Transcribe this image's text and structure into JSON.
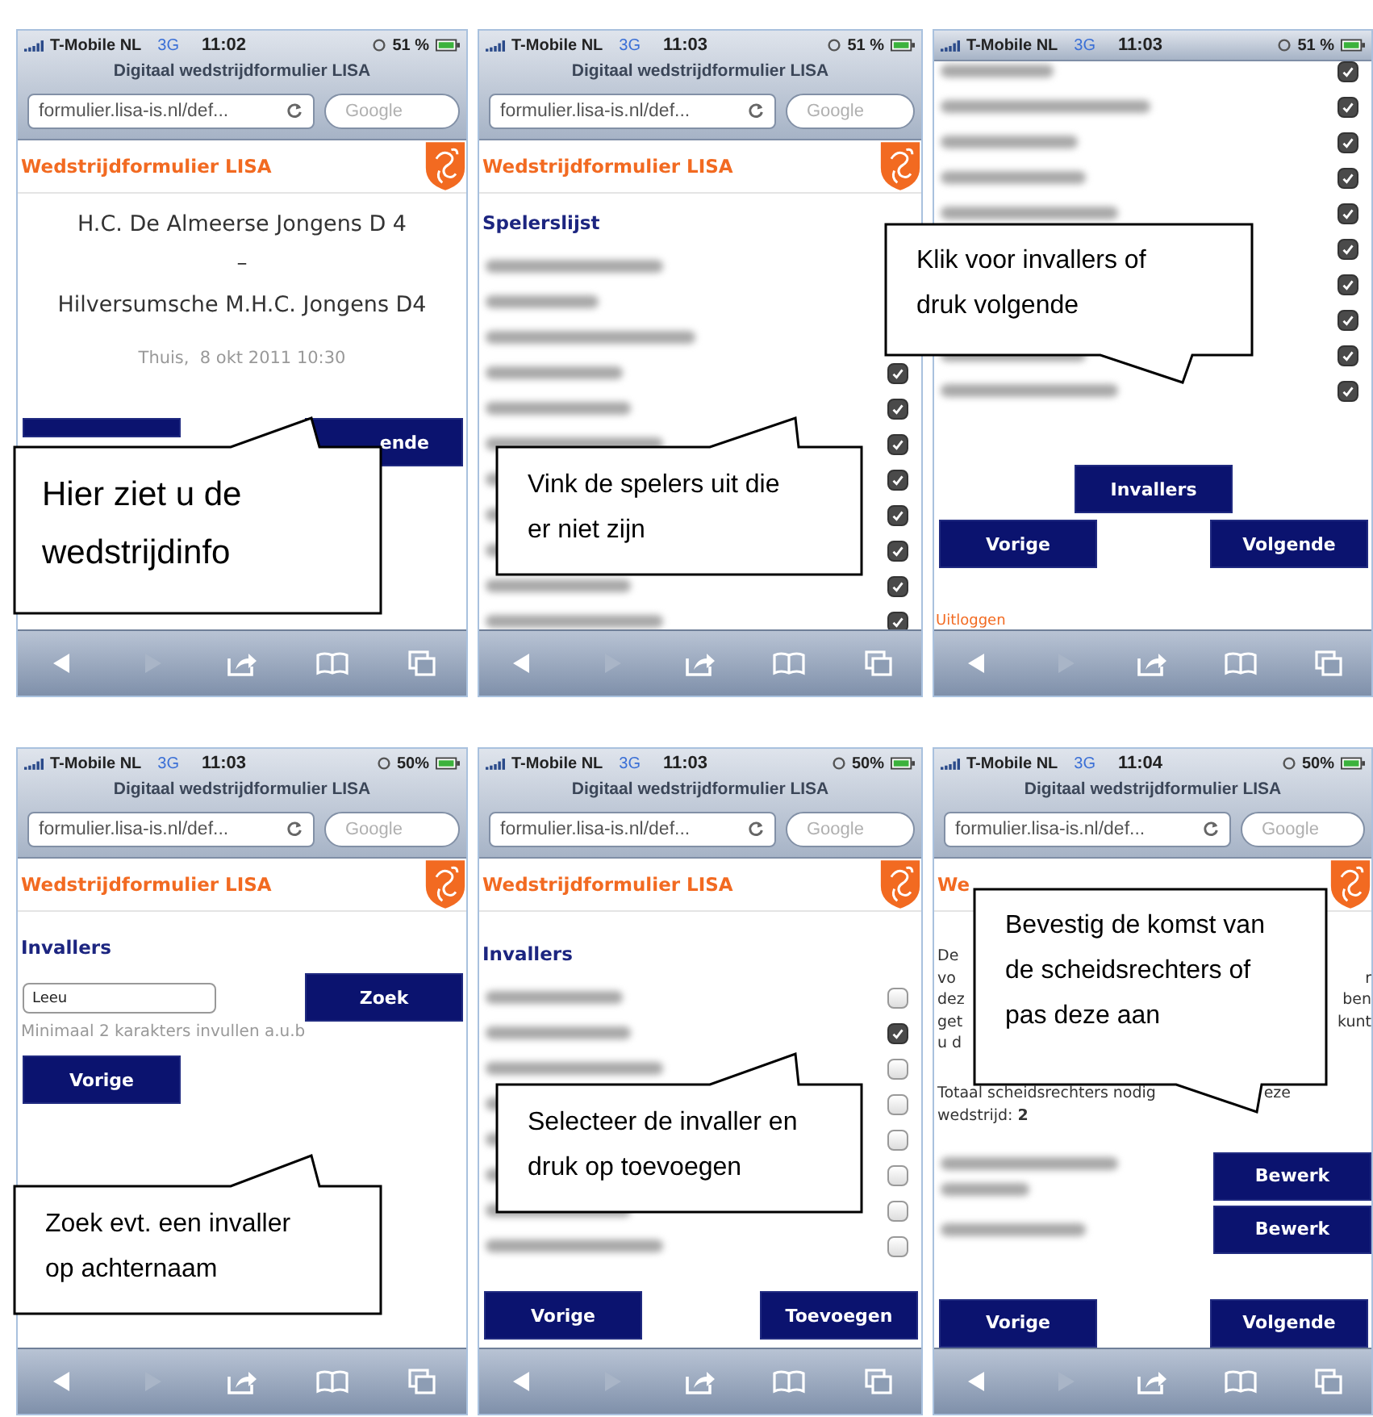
{
  "phones": [
    {
      "status": {
        "carrier": "T-Mobile NL",
        "network": "3G",
        "time": "11:02",
        "battery": "51 %"
      },
      "title": "Digitaal wedstrijdformulier LISA",
      "url": "formulier.lisa-is.nl/def...",
      "search_placeholder": "Google",
      "header": "Wedstrijdformulier LISA",
      "content": [
        {
          "kind": "match",
          "home": "H.C. De Almeerse Jongens D 4",
          "separator": "–",
          "away": "Hilversumsche M.H.C. Jongens D4",
          "info": "Thuis,  8 okt 2011 10:30"
        },
        {
          "kind": "buttons",
          "buttons": [
            {
              "kind": "covered"
            },
            {
              "kind": "tail",
              "label": "ende"
            }
          ]
        }
      ],
      "callout": "Hier ziet u de wedstrijdinfo"
    },
    {
      "status": {
        "carrier": "T-Mobile NL",
        "network": "3G",
        "time": "11:03",
        "battery": "51 %"
      },
      "title": "Digitaal wedstrijdformulier LISA",
      "url": "formulier.lisa-is.nl/def...",
      "search_placeholder": "Google",
      "header": "Wedstrijdformulier LISA",
      "content": [
        {
          "kind": "heading",
          "text": "Spelerslijst"
        },
        {
          "kind": "list",
          "rows": [
            {
              "kind": "name"
            },
            {
              "kind": "name"
            },
            {
              "kind": "name"
            },
            {
              "kind": "check",
              "checked": true
            },
            {
              "kind": "check",
              "checked": true
            },
            {
              "kind": "check",
              "checked": true
            },
            {
              "kind": "check",
              "checked": true
            },
            {
              "kind": "check",
              "checked": true
            },
            {
              "kind": "check",
              "checked": true
            },
            {
              "kind": "check",
              "checked": true
            },
            {
              "kind": "check",
              "checked": true
            }
          ]
        }
      ],
      "callout": "Vink de spelers uit die er niet zijn"
    },
    {
      "status": {
        "carrier": "T-Mobile NL",
        "network": "3G",
        "time": "11:03",
        "battery": "51 %"
      },
      "content": [
        {
          "kind": "list",
          "rows": [
            {
              "kind": "check",
              "checked": true
            },
            {
              "kind": "check",
              "checked": true
            },
            {
              "kind": "check",
              "checked": true
            },
            {
              "kind": "check",
              "checked": true
            },
            {
              "kind": "check",
              "checked": true
            },
            {
              "kind": "check",
              "checked": true
            },
            {
              "kind": "check",
              "checked": true
            },
            {
              "kind": "check",
              "checked": true
            },
            {
              "kind": "check",
              "checked": true
            },
            {
              "kind": "check",
              "checked": true
            }
          ]
        },
        {
          "kind": "buttons",
          "buttons": [
            {
              "kind": "centered",
              "label": "Invallers"
            }
          ]
        },
        {
          "kind": "buttons",
          "buttons": [
            {
              "kind": "full",
              "label": "Vorige"
            },
            {
              "kind": "full",
              "label": "Volgende"
            }
          ]
        },
        {
          "kind": "logout",
          "text": "Uitloggen"
        }
      ],
      "callout": "Klik voor invallers of druk volgende"
    },
    {
      "status": {
        "carrier": "T-Mobile NL",
        "network": "3G",
        "time": "11:03",
        "battery": "50%"
      },
      "title": "Digitaal wedstrijdformulier LISA",
      "url": "formulier.lisa-is.nl/def...",
      "search_placeholder": "Google",
      "header": "Wedstrijdformulier LISA",
      "content": [
        {
          "kind": "heading",
          "text": "Invallers"
        },
        {
          "kind": "search",
          "value": "Leeu",
          "button": "Zoek",
          "hint": "Minimaal 2 karakters invullen a.u.b"
        },
        {
          "kind": "buttons",
          "buttons": [
            {
              "kind": "full",
              "label": "Vorige"
            }
          ]
        }
      ],
      "callout": "Zoek evt. een invaller op achternaam"
    },
    {
      "status": {
        "carrier": "T-Mobile NL",
        "network": "3G",
        "time": "11:03",
        "battery": "50%"
      },
      "title": "Digitaal wedstrijdformulier LISA",
      "url": "formulier.lisa-is.nl/def...",
      "search_placeholder": "Google",
      "header": "Wedstrijdformulier LISA",
      "content": [
        {
          "kind": "heading",
          "text": "Invallers"
        },
        {
          "kind": "list",
          "rows": [
            {
              "kind": "check",
              "checked": false
            },
            {
              "kind": "check",
              "checked": true
            },
            {
              "kind": "check",
              "checked": false
            },
            {
              "kind": "check",
              "checked": false
            },
            {
              "kind": "check",
              "checked": false
            },
            {
              "kind": "check",
              "checked": false
            },
            {
              "kind": "check",
              "checked": false
            },
            {
              "kind": "check",
              "checked": false
            }
          ]
        },
        {
          "kind": "buttons",
          "buttons": [
            {
              "kind": "full",
              "label": "Vorige"
            },
            {
              "kind": "full",
              "label": "Toevoegen"
            }
          ]
        }
      ],
      "callout": "Selecteer de invaller en druk op toevoegen"
    },
    {
      "status": {
        "carrier": "T-Mobile NL",
        "network": "3G",
        "time": "11:04",
        "battery": "50%"
      },
      "title": "Digitaal wedstrijdformulier LISA",
      "url": "formulier.lisa-is.nl/def...",
      "search_placeholder": "Google",
      "header": "We",
      "content": [
        {
          "kind": "notice",
          "lines": [
            {
              "left": "De"
            },
            {
              "left": "vo",
              "right": "r"
            },
            {
              "left": "dez",
              "right": "ben"
            },
            {
              "left": "get",
              "right": "kunt"
            },
            {
              "left": "u d"
            }
          ]
        },
        {
          "kind": "total",
          "lines": [
            {
              "left": "Totaal scheidsrechters nodig",
              "right": "eze"
            },
            {
              "left": "wedstrijd: **2**"
            }
          ]
        },
        {
          "kind": "referees",
          "rows": [
            {
              "kind": "two-line",
              "button": "Bewerk"
            },
            {
              "kind": "one-line",
              "button": "Bewerk"
            }
          ]
        },
        {
          "kind": "buttons",
          "buttons": [
            {
              "kind": "full",
              "label": "Vorige"
            },
            {
              "kind": "full",
              "label": "Volgende"
            }
          ]
        }
      ],
      "callout": "Bevestig de komst van de scheidsrechters of pas deze aan"
    }
  ]
}
